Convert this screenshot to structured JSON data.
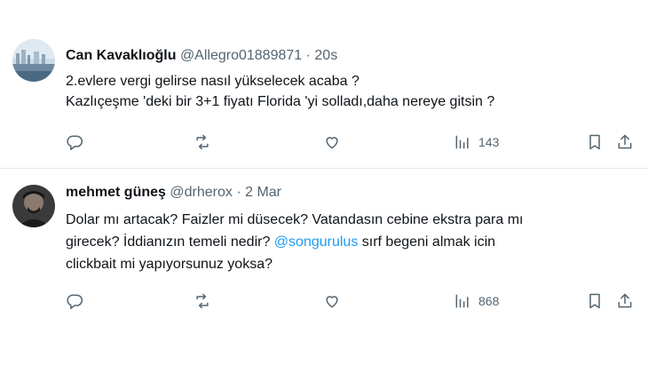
{
  "tweets": [
    {
      "name": "Can Kavaklıoğlu",
      "handle": "@Allegro01889871",
      "separator": "·",
      "time": "20s",
      "lines": [
        "2.evlere vergi gelirse nasıl yükselecek acaba ?",
        "Kazlıçeşme 'deki bir 3+1 fiyatı Florida 'yi solladı,daha nereye gitsin ?"
      ],
      "views": "143"
    },
    {
      "name": "mehmet güneş",
      "handle": "@drherox",
      "separator": "·",
      "time": "2 Mar",
      "line1": "Dolar mı artacak? Faizler mi düsecek? Vatandasın cebine ekstra para mı",
      "line2_before": "girecek? İddianızın temeli nedir? ",
      "mention": "@songurulus",
      "line2_after": " sırf begeni almak icin",
      "line3": "clickbait mi yapıyorsunuz yoksa?",
      "views": "868"
    }
  ],
  "colors": {
    "mention": "#1d9bf0",
    "meta": "#536471",
    "text": "#0f1419"
  },
  "icons": [
    "reply-icon",
    "retweet-icon",
    "like-icon",
    "views-icon",
    "bookmark-icon",
    "share-icon"
  ]
}
